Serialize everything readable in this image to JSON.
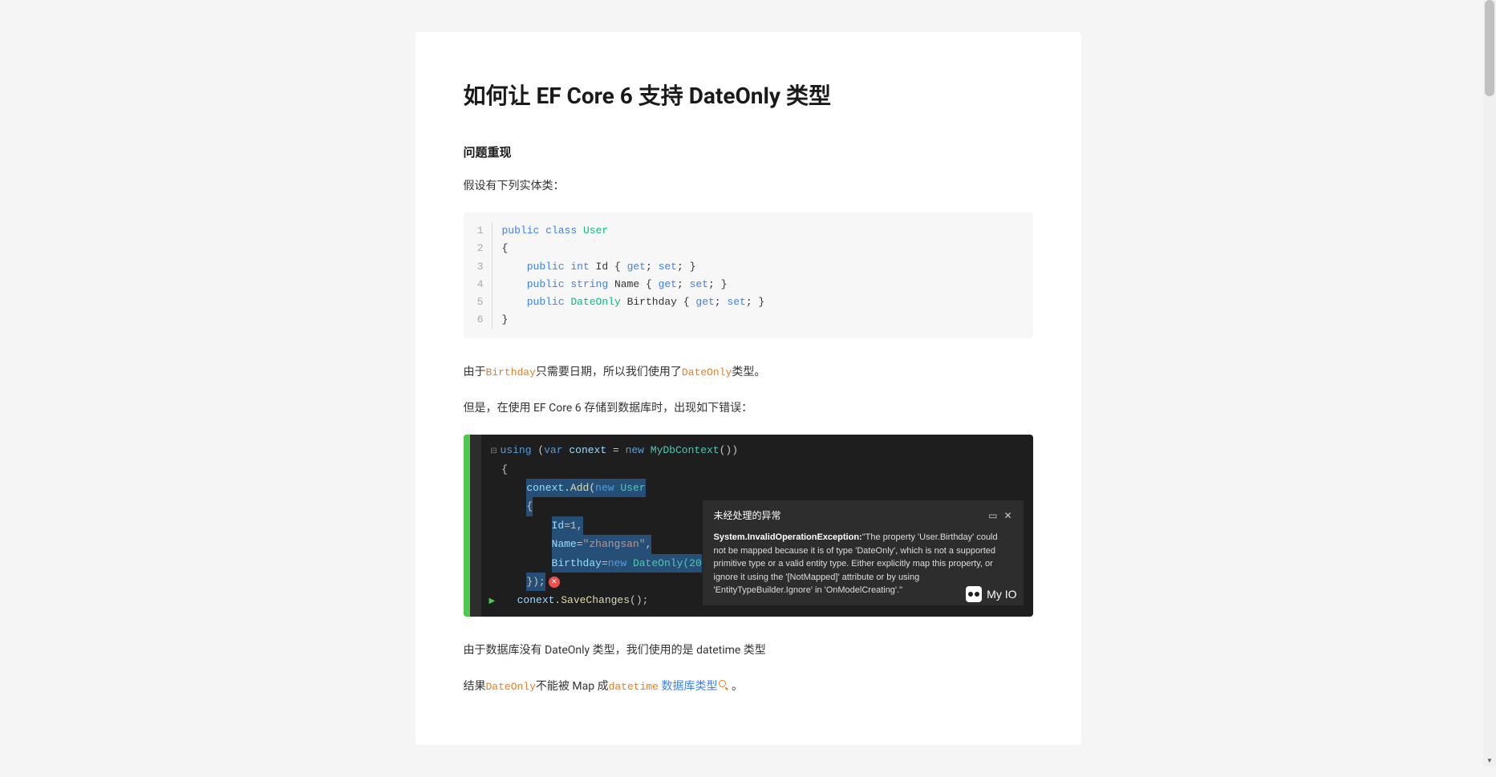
{
  "article": {
    "title": "如何让 EF Core 6 支持 DateOnly 类型",
    "section1_heading": "问题重现",
    "para1": "假设有下列实体类：",
    "para2_prefix": "由于",
    "para2_code1": "Birthday",
    "para2_mid": "只需要日期，所以我们使用了",
    "para2_code2": "DateOnly",
    "para2_suffix": "类型。",
    "para3": "但是，在使用 EF Core 6 存储到数据库时，出现如下错误：",
    "para4": "由于数据库没有 DateOnly 类型，我们使用的是 datetime 类型",
    "para5_prefix": "结果",
    "para5_code1": "DateOnly",
    "para5_mid": "不能被 Map 成",
    "para5_code2": "datetime",
    "para5_link": "数据库类型",
    "para5_suffix": "。"
  },
  "code_block": {
    "lines": [
      {
        "num": "1",
        "tokens": [
          {
            "t": "public",
            "c": "kw-public"
          },
          {
            "t": " ",
            "c": ""
          },
          {
            "t": "class",
            "c": "kw-class"
          },
          {
            "t": " ",
            "c": ""
          },
          {
            "t": "User",
            "c": "kw-type"
          }
        ]
      },
      {
        "num": "2",
        "tokens": [
          {
            "t": "{",
            "c": "kw-brace"
          }
        ]
      },
      {
        "num": "3",
        "tokens": [
          {
            "t": "    ",
            "c": ""
          },
          {
            "t": "public",
            "c": "kw-public"
          },
          {
            "t": " ",
            "c": ""
          },
          {
            "t": "int",
            "c": "kw-int"
          },
          {
            "t": " Id { ",
            "c": ""
          },
          {
            "t": "get",
            "c": "kw-accessor"
          },
          {
            "t": "; ",
            "c": ""
          },
          {
            "t": "set",
            "c": "kw-accessor"
          },
          {
            "t": "; }",
            "c": ""
          }
        ]
      },
      {
        "num": "4",
        "tokens": [
          {
            "t": "    ",
            "c": ""
          },
          {
            "t": "public",
            "c": "kw-public"
          },
          {
            "t": " ",
            "c": ""
          },
          {
            "t": "string",
            "c": "kw-string"
          },
          {
            "t": " Name { ",
            "c": ""
          },
          {
            "t": "get",
            "c": "kw-accessor"
          },
          {
            "t": "; ",
            "c": ""
          },
          {
            "t": "set",
            "c": "kw-accessor"
          },
          {
            "t": "; }",
            "c": ""
          }
        ]
      },
      {
        "num": "5",
        "tokens": [
          {
            "t": "    ",
            "c": ""
          },
          {
            "t": "public",
            "c": "kw-public"
          },
          {
            "t": " ",
            "c": ""
          },
          {
            "t": "DateOnly",
            "c": "kw-type"
          },
          {
            "t": " Birthday { ",
            "c": ""
          },
          {
            "t": "get",
            "c": "kw-accessor"
          },
          {
            "t": "; ",
            "c": ""
          },
          {
            "t": "set",
            "c": "kw-accessor"
          },
          {
            "t": "; }",
            "c": ""
          }
        ]
      },
      {
        "num": "6",
        "tokens": [
          {
            "t": "}",
            "c": "kw-brace"
          }
        ]
      }
    ]
  },
  "ide": {
    "line1_using": "using",
    "line1_var": "var",
    "line1_conext": "conext",
    "line1_eq": " = ",
    "line1_new": "new",
    "line1_type": "MyDbContext",
    "line1_end": "())",
    "line2": "{",
    "line3_conext": "conext",
    "line3_add": ".Add(",
    "line3_new": "new",
    "line3_user": " User",
    "line4": "{",
    "line5_id": "Id",
    "line5_val": "=1,",
    "line6_name": "Name",
    "line6_eq": "=",
    "line6_str": "\"zhangsan\"",
    "line6_end": ",",
    "line7_bday": "Birthday",
    "line7_eq": "=",
    "line7_new": "new",
    "line7_type": " DateOnly(20",
    "line8": "});",
    "line9_conext": "conext",
    "line9_method": ".SaveChanges",
    "line9_end": "();",
    "exception_title": "未经处理的异常",
    "exception_type": "System.InvalidOperationException:",
    "exception_msg": "\"The property 'User.Birthday' could not be mapped because it is of type 'DateOnly', which is not a supported primitive type or a valid entity type. Either explicitly map this property, or ignore it using the '[NotMapped]' attribute or by using 'EntityTypeBuilder.Ignore' in 'OnModelCreating'.\"",
    "watermark": "My IO"
  }
}
